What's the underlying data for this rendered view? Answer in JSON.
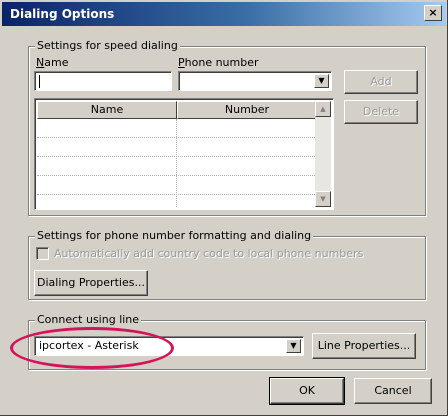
{
  "window": {
    "title": "Dialing Options",
    "close_glyph": "×"
  },
  "speed_dialing": {
    "group_label": "Settings for speed dialing",
    "name_label_hotkey": "N",
    "name_label_rest": "ame",
    "name_value": "",
    "phone_label_hotkey": "P",
    "phone_label_rest": "hone number",
    "phone_value": "",
    "add_label": "Add",
    "delete_label": "Delete",
    "columns": [
      "Name",
      "Number"
    ],
    "rows": []
  },
  "formatting": {
    "group_label": "Settings for phone number formatting and dialing",
    "auto_country_code_label": "Automatically add country code to local phone numbers",
    "auto_country_code_checked": false,
    "dialing_properties_label": "Dialing Properties..."
  },
  "connect": {
    "group_label": "Connect using line",
    "line_value": "ipcortex - Asterisk",
    "line_properties_label": "Line Properties..."
  },
  "footer": {
    "ok_label": "OK",
    "cancel_label": "Cancel"
  },
  "colors": {
    "title_bar": "#0a246a",
    "highlight_ellipse": "#d4145a",
    "dialog_face": "#d4d0c8"
  },
  "icons": {
    "combo_arrow": "▼",
    "scroll_up": "▲",
    "scroll_down": "▼"
  }
}
